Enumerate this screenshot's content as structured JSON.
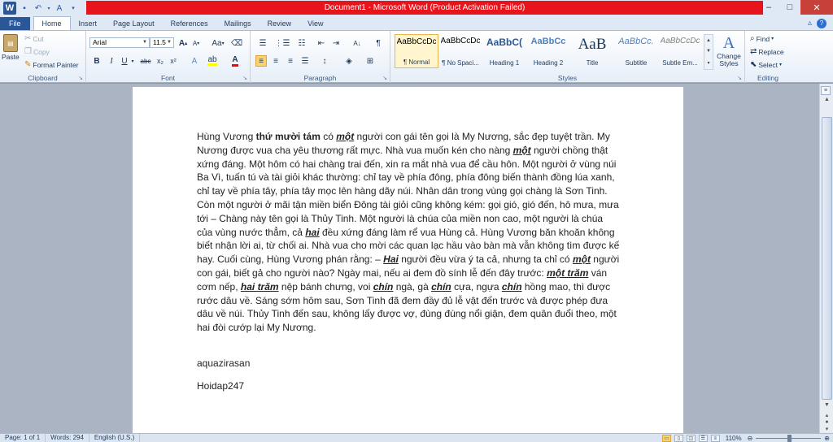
{
  "window": {
    "title": "Document1 - Microsoft Word (Product Activation Failed)",
    "title_bar_color": "#e8141c",
    "minimize": "–",
    "maximize": "□",
    "close": "✕"
  },
  "tabs": [
    "File",
    "Home",
    "Insert",
    "Page Layout",
    "References",
    "Mailings",
    "Review",
    "View"
  ],
  "active_tab": "Home",
  "clipboard": {
    "paste": "Paste",
    "cut": "Cut",
    "copy": "Copy",
    "format_painter": "Format Painter",
    "label": "Clipboard"
  },
  "font": {
    "name": "Arial",
    "size": "11.5",
    "case_button": "Aa",
    "bold": "B",
    "italic": "I",
    "underline": "U",
    "strikethrough": "abc",
    "subscript": "x₂",
    "superscript": "x²",
    "grow": "A",
    "shrink": "A",
    "highlight_color": "#ffff00",
    "font_color": "#ff0000",
    "label": "Font"
  },
  "paragraph": {
    "label": "Paragraph",
    "sort": "A↓",
    "pilcrow": "¶"
  },
  "styles": {
    "label": "Styles",
    "items": [
      {
        "sample": "AaBbCcDc",
        "name": "¶ Normal"
      },
      {
        "sample": "AaBbCcDc",
        "name": "¶ No Spaci..."
      },
      {
        "sample": "AaBbC(",
        "name": "Heading 1"
      },
      {
        "sample": "AaBbCc",
        "name": "Heading 2"
      },
      {
        "sample": "AaB",
        "name": "Title"
      },
      {
        "sample": "AaBbCc.",
        "name": "Subtitle"
      },
      {
        "sample": "AaBbCcDc",
        "name": "Subtle Em..."
      }
    ],
    "change_styles": "Change Styles"
  },
  "editing": {
    "label": "Editing",
    "find": "Find",
    "replace": "Replace",
    "select": "Select"
  },
  "document": {
    "paragraph1": [
      {
        "t": "Hùng Vương ",
        "s": ""
      },
      {
        "t": "thứ mười tám",
        "s": "b"
      },
      {
        "t": " có ",
        "s": ""
      },
      {
        "t": "một",
        "s": "biu"
      },
      {
        "t": " người con gái tên gọi là My Nương, sắc đẹp tuyệt trần. My Nương được vua cha yêu thương rất mực. Nhà vua muốn kén cho nàng ",
        "s": ""
      },
      {
        "t": "một",
        "s": "biu"
      },
      {
        "t": " người chồng thật xứng đáng. Một hôm có hai chàng trai đến, xin ra mắt nhà vua để cầu hôn. Một người ở vùng núi Ba Vì, tuấn tú và tài giỏi khác thường: chỉ tay về phía đông, phía đông biến thành đồng lúa xanh, chỉ tay về phía tây, phía tây mọc lên hàng dãy núi. Nhân dân trong vùng gọi chàng là Sơn Tinh. Còn một người ở mãi tận miền biển Đông tài giỏi cũng không kém: gọi gió, gió đến, hô mưa, mưa tới – Chàng này tên gọi là Thủy Tinh. Một người là chúa của miền non cao, một người là chúa của vùng nước thẳm, cả ",
        "s": ""
      },
      {
        "t": "hai",
        "s": "biu"
      },
      {
        "t": " đều xứng đáng làm rể vua Hùng cả. Hùng Vương băn khoăn không biết nhận lời ai, từ chối ai. Nhà vua cho mời các quan lạc hầu vào bàn mà vẫn không tìm được kế hay. Cuối cùng, Hùng Vương phán rằng: – ",
        "s": ""
      },
      {
        "t": "Hai",
        "s": "biu"
      },
      {
        "t": " người đều vừa ý ta cả, nhưng ta chỉ có ",
        "s": ""
      },
      {
        "t": "một",
        "s": "biu"
      },
      {
        "t": " người con gái, biết gả cho người nào? Ngày mai, nếu ai đem đồ sính lễ đến đây trước: ",
        "s": ""
      },
      {
        "t": "một trăm",
        "s": "biu"
      },
      {
        "t": " ván cơm nếp, ",
        "s": ""
      },
      {
        "t": "hai trăm",
        "s": "biu"
      },
      {
        "t": " nệp bánh chưng, voi ",
        "s": ""
      },
      {
        "t": "chín",
        "s": "biu"
      },
      {
        "t": " ngà, gà ",
        "s": ""
      },
      {
        "t": "chín",
        "s": "biu"
      },
      {
        "t": " cựa, ngựa ",
        "s": ""
      },
      {
        "t": "chín",
        "s": "biu"
      },
      {
        "t": " hồng mao, thì được rước dâu về. Sáng sớm hôm sau, Sơn Tinh đã đem đầy đủ lễ vật đến trước và được phép đưa dâu về núi. Thủy Tinh đến sau, không lấy được vợ, đùng đùng nổi giận, đem quân đuổi theo, một hai đòi cướp lại My Nương.",
        "s": ""
      }
    ],
    "paragraph2": "aquazirasan",
    "paragraph3": "Hoidap247"
  },
  "status": {
    "page": "Page: 1 of 1",
    "words": "Words: 294",
    "language": "English (U.S.)",
    "zoom": "110%",
    "zoom_level": 110
  }
}
